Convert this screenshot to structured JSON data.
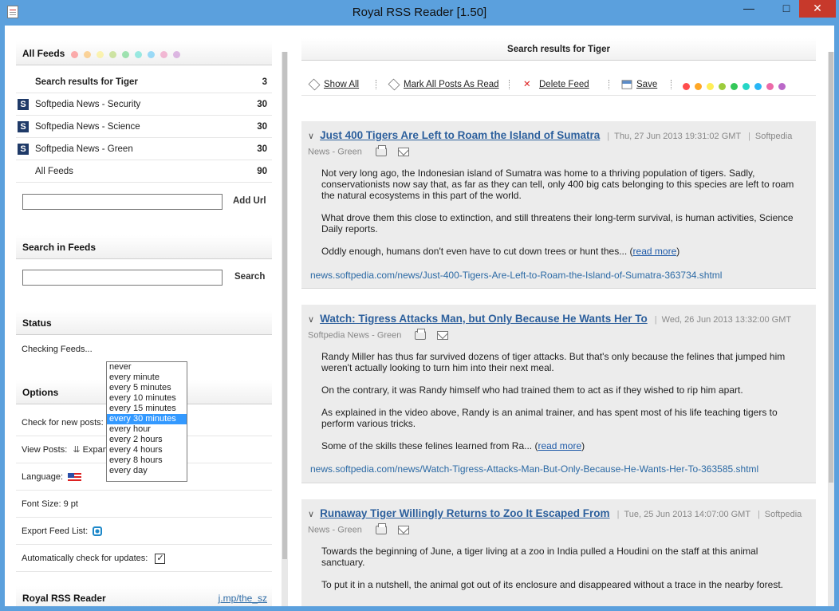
{
  "window": {
    "title": "Royal RSS Reader [1.50]",
    "min_glyph": "—",
    "max_glyph": "□",
    "close_glyph": "✕"
  },
  "colors": [
    "#ff4d4d",
    "#ffa726",
    "#ffee58",
    "#9ccc3c",
    "#34c759",
    "#26d6c6",
    "#29b6f6",
    "#ec6aa8",
    "#ba68c8"
  ],
  "left": {
    "all_feeds_header": "All Feeds",
    "feeds": [
      {
        "label": "Search results for Tiger",
        "count": "3",
        "icon": ""
      },
      {
        "label": "Softpedia News - Security",
        "count": "30",
        "icon": "S"
      },
      {
        "label": "Softpedia News - Science",
        "count": "30",
        "icon": "S"
      },
      {
        "label": "Softpedia News - Green",
        "count": "30",
        "icon": "S"
      },
      {
        "label": "All Feeds",
        "count": "90",
        "icon": ""
      }
    ],
    "add_url_label": "Add Url",
    "search_header": "Search in Feeds",
    "search_button": "Search",
    "status_header": "Status",
    "status_text": "Checking Feeds...",
    "options_header": "Options",
    "options": {
      "check_new_posts": "Check for new posts:",
      "view_posts": "View Posts:",
      "view_posts_value": "Expan",
      "language": "Language:",
      "font_size": "Font Size: 9 pt",
      "export_feed_list": "Export Feed List:",
      "auto_update": "Automatically check for updates:"
    },
    "footer_title": "Royal RSS Reader",
    "footer_link": "j.mp/the_sz"
  },
  "dropdown": {
    "items": [
      "never",
      "every minute",
      "every 5 minutes",
      "every 10 minutes",
      "every 15 minutes",
      "every 30 minutes",
      "every hour",
      "every 2 hours",
      "every 4 hours",
      "every 8 hours",
      "every day"
    ],
    "selected_index": 5
  },
  "right": {
    "header": "Search results for Tiger",
    "toolbar": {
      "show_all": "Show All",
      "mark_all_read": "Mark All Posts As Read",
      "delete_feed": "Delete Feed",
      "save": "Save"
    },
    "articles": [
      {
        "title": "Just 400 Tigers Are Left to Roam the Island of Sumatra",
        "date": "Thu, 27 Jun 2013 19:31:02 GMT",
        "source_a": "Softpedia",
        "source_b": "News - Green",
        "paragraphs": [
          "Not very long ago, the Indonesian island of Sumatra was home to a thriving population of tigers. Sadly, conservationists now say that, as far as they can tell, only 400 big cats belonging to this species are left to roam the natural ecosystems in this part of the world.",
          "What drove them this close to extinction, and still threatens their long-term survival, is human activities, Science Daily reports.",
          "Oddly enough, humans don't even have to cut down trees or hunt thes... ("
        ],
        "read_more": "read more",
        "read_more_close": ")",
        "url": "news.softpedia.com/news/Just-400-Tigers-Are-Left-to-Roam-the-Island-of-Sumatra-363734.shtml"
      },
      {
        "title": "Watch: Tigress Attacks Man, but Only Because He Wants Her To",
        "date": "Wed, 26 Jun 2013 13:32:00 GMT",
        "source_a": "Softpedia News - Green",
        "paragraphs": [
          "Randy Miller has thus far survived dozens of tiger attacks. But that's only because the felines that jumped him weren't actually looking to turn him into their next meal.",
          "On the contrary, it was Randy himself who had trained them to act as if they wished to rip him apart.",
          "As explained in the video above, Randy is an animal trainer, and has spent most of his life teaching tigers to perform various tricks.",
          "Some of the skills these felines learned from Ra... ("
        ],
        "read_more": "read more",
        "read_more_close": ")",
        "url": "news.softpedia.com/news/Watch-Tigress-Attacks-Man-But-Only-Because-He-Wants-Her-To-363585.shtml"
      },
      {
        "title": "Runaway Tiger Willingly Returns to Zoo It Escaped From",
        "date": "Tue, 25 Jun 2013 14:07:00 GMT",
        "source_a": "Softpedia",
        "source_b": "News - Green",
        "paragraphs": [
          "Towards the beginning of June, a tiger living at a zoo in India pulled a Houdini on the staff at this animal sanctuary.",
          "To put it in a nutshell, the animal got out of its enclosure and disappeared without a trace in the nearby forest."
        ]
      }
    ]
  }
}
